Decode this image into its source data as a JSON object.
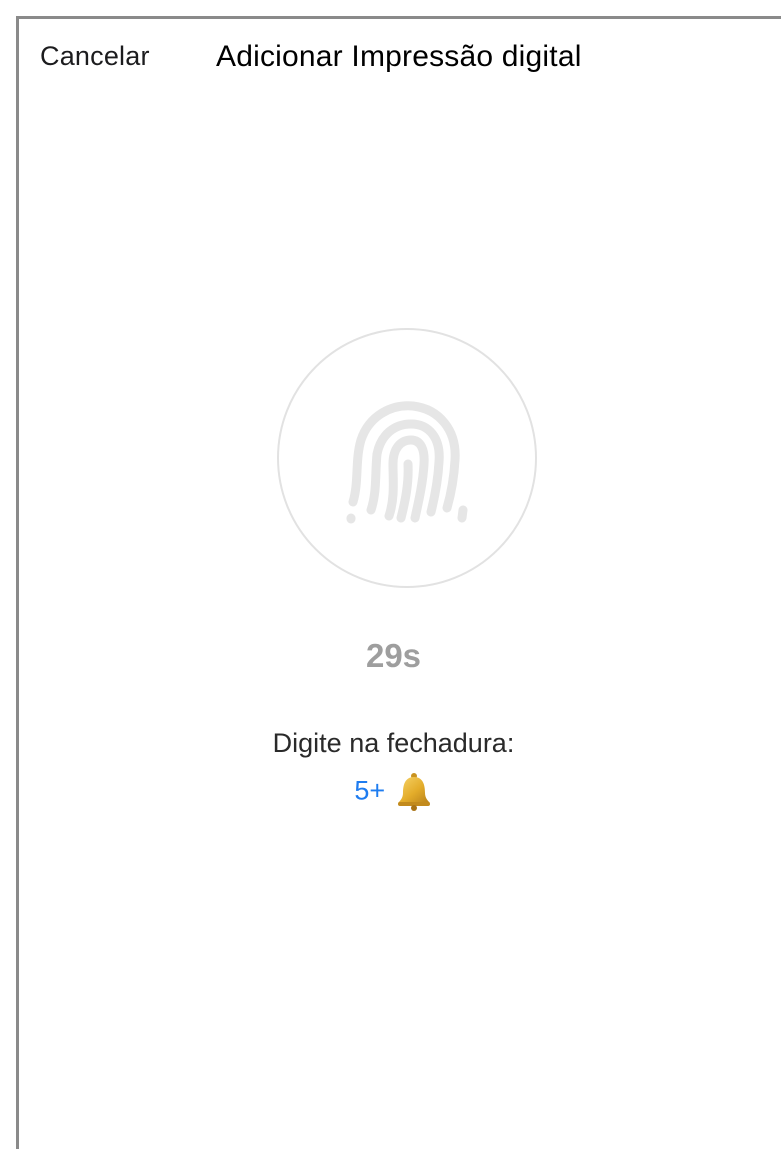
{
  "header": {
    "cancel_label": "Cancelar",
    "title": "Adicionar Impressão digital"
  },
  "main": {
    "fingerprint_icon": "fingerprint-icon",
    "timer": "29s",
    "instruction": "Digite na fechadura:",
    "code": "5+",
    "code_icon": "bell-icon"
  },
  "colors": {
    "accent": "#1e7cf0",
    "timer": "#9e9e9e",
    "circle_border": "#e2e2e2",
    "fingerprint": "#e6e6e6"
  }
}
